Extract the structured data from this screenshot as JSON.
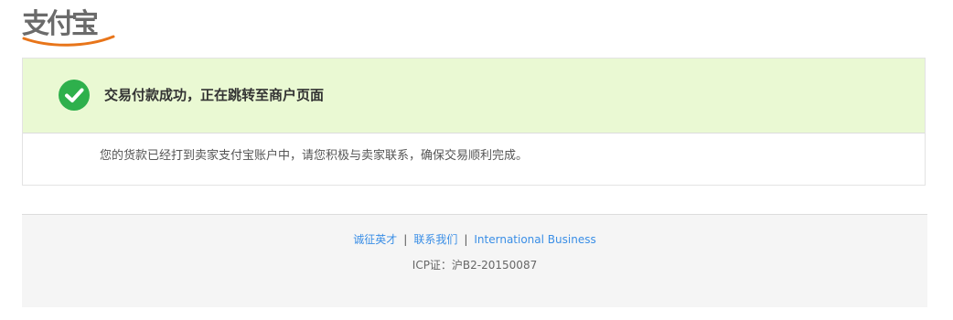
{
  "header": {
    "logo_text": "支付宝"
  },
  "result": {
    "title": "交易付款成功，正在跳转至商户页面",
    "description": "您的货款已经打到卖家支付宝账户中，请您积极与卖家联系，确保交易顺利完成。",
    "status_icon": "check-circle-icon",
    "colors": {
      "success_bg": "#eaf9d3",
      "check": "#2eb04c"
    }
  },
  "footer": {
    "links": [
      {
        "label": "诚征英才"
      },
      {
        "label": "联系我们"
      },
      {
        "label": "International Business"
      }
    ],
    "separator": "|",
    "icp": "ICP证：沪B2-20150087",
    "link_color": "#3a8ee6"
  }
}
